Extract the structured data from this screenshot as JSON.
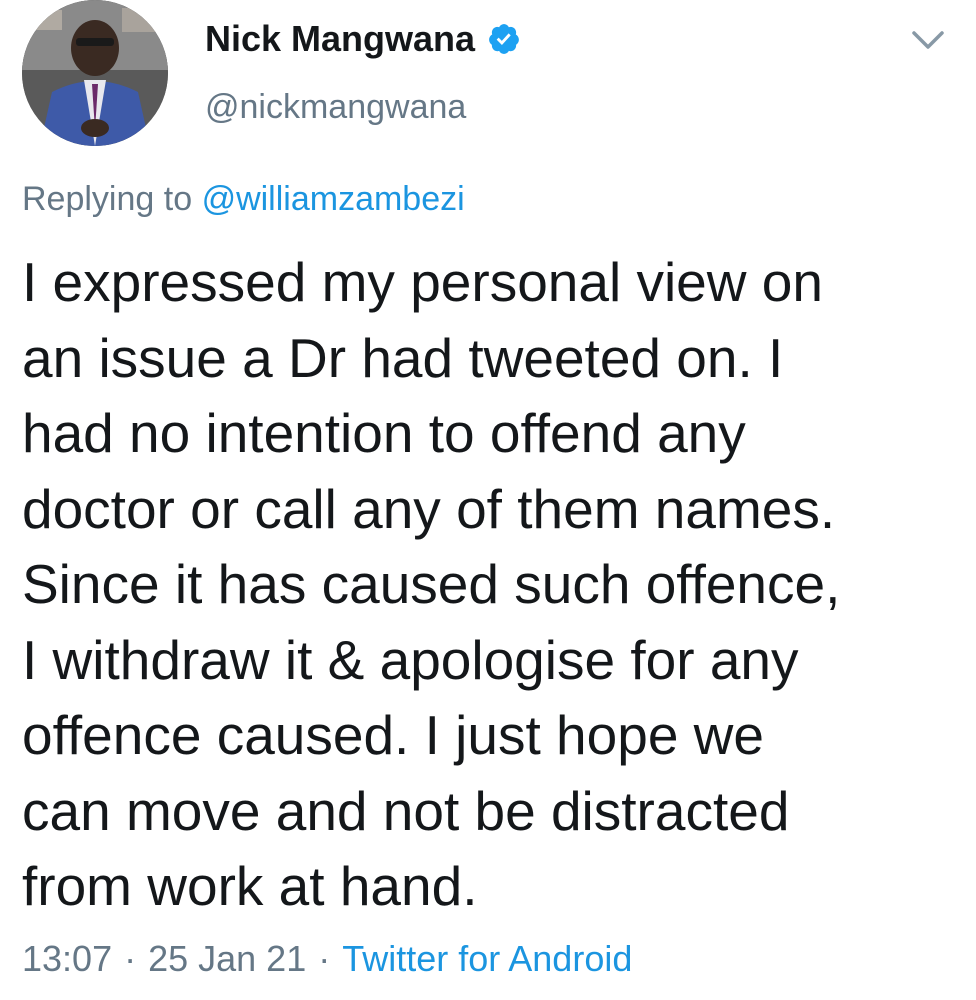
{
  "tweet": {
    "author": {
      "display_name": "Nick Mangwana",
      "handle": "@nickmangwana",
      "verified": true,
      "avatar_icon": "profile-photo"
    },
    "menu_icon": "chevron-down-icon",
    "replying_to": {
      "prefix": "Replying to",
      "mention": "@williamzambezi"
    },
    "text": "I expressed my personal view on\nan issue a Dr had tweeted on. I\nhad no intention to offend any\ndoctor or call any of them names.\nSince it has caused such offence,\nI withdraw it & apologise for any\noffence caused. I just hope we\ncan move and not be distracted\nfrom work at hand.",
    "time": "13:07",
    "date": "25 Jan 21",
    "separator": "·",
    "source": "Twitter for Android"
  },
  "colors": {
    "text": "#14171a",
    "secondary": "#657786",
    "link": "#1b95e0",
    "verified_badge": "#1da1f2"
  }
}
